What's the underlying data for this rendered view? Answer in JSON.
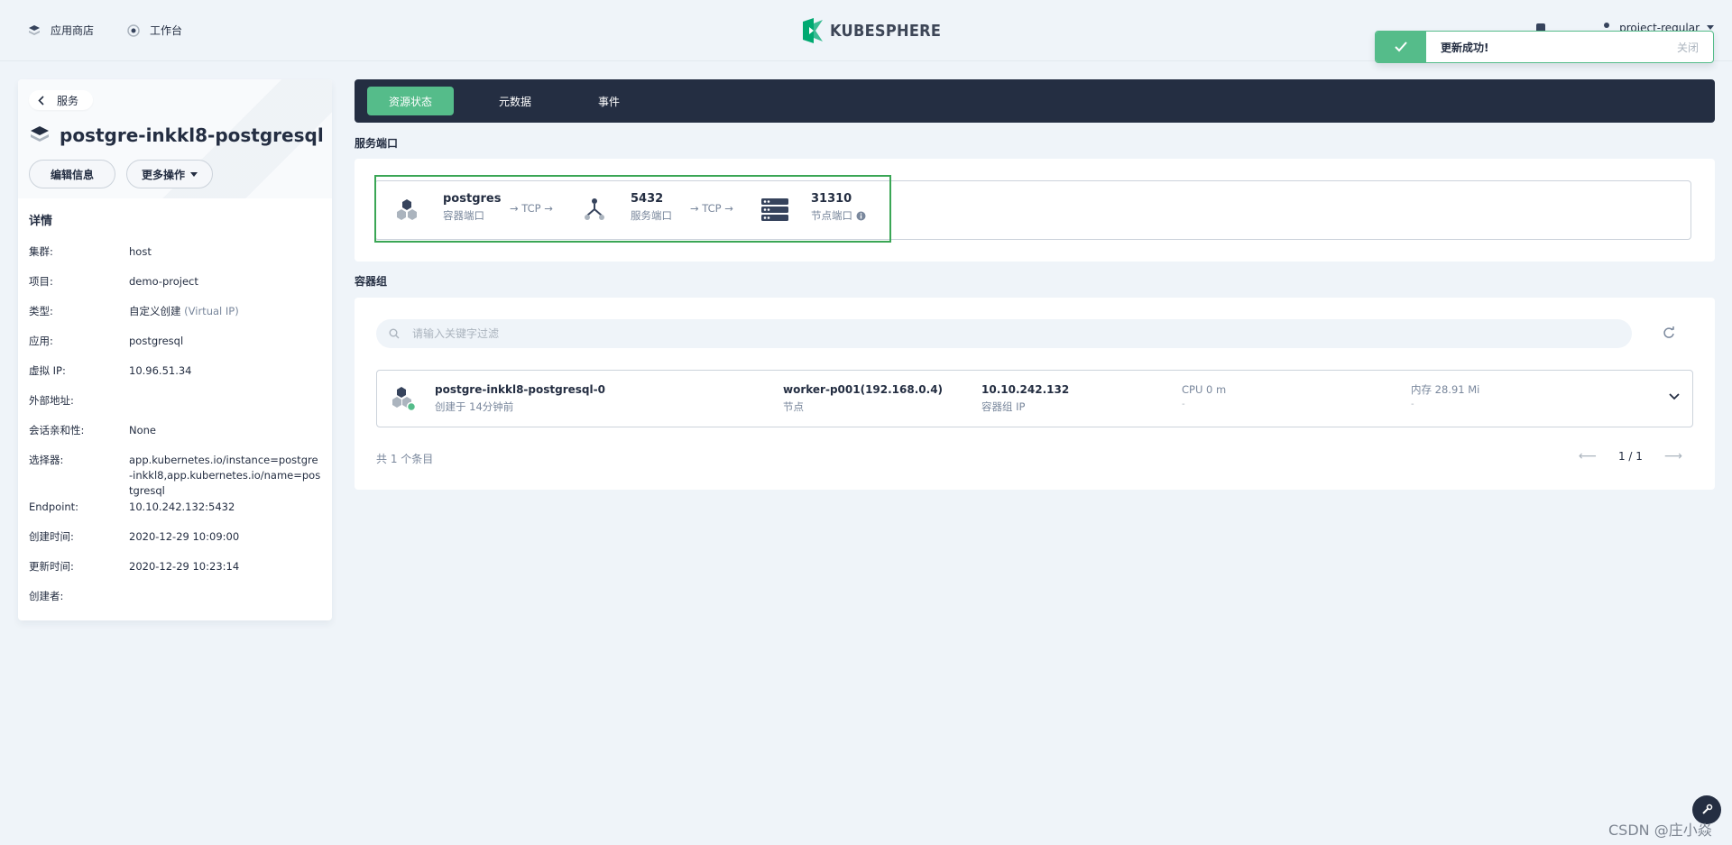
{
  "topnav": {
    "app_store": "应用商店",
    "workbench": "工作台",
    "logo": "KUBESPHERE",
    "user": "project-regular"
  },
  "toast": {
    "message": "更新成功!",
    "close": "关闭"
  },
  "left": {
    "back_label": "服务",
    "service_name": "postgre-inkkl8-postgresql",
    "edit_button": "编辑信息",
    "more_button": "更多操作",
    "details_title": "详情",
    "details": [
      {
        "key": "集群:",
        "value": "host"
      },
      {
        "key": "项目:",
        "value": "demo-project"
      },
      {
        "key": "类型:",
        "value": "自定义创建",
        "extra": "(Virtual IP)"
      },
      {
        "key": "应用:",
        "value": "postgresql"
      },
      {
        "key": "虚拟 IP:",
        "value": "10.96.51.34"
      },
      {
        "key": "外部地址:",
        "value": ""
      },
      {
        "key": "会话亲和性:",
        "value": "None"
      },
      {
        "key": "选择器:",
        "value": "app.kubernetes.io/instance=postgre-inkkl8,app.kubernetes.io/name=postgresql"
      },
      {
        "key": "Endpoint:",
        "value": "10.10.242.132:5432"
      },
      {
        "key": "创建时间:",
        "value": "2020-12-29 10:09:00"
      },
      {
        "key": "更新时间:",
        "value": "2020-12-29 10:23:14"
      },
      {
        "key": "创建者:",
        "value": ""
      }
    ]
  },
  "tabs": [
    "资源状态",
    "元数据",
    "事件"
  ],
  "ports": {
    "section_title": "服务端口",
    "container_port_name": "postgres",
    "container_port_label": "容器端口",
    "protocol1": "→ TCP →",
    "service_port": "5432",
    "service_port_label": "服务端口",
    "protocol2": "→ TCP →",
    "node_port": "31310",
    "node_port_label": "节点端口"
  },
  "pods": {
    "section_title": "容器组",
    "search_placeholder": "请输入关键字过滤",
    "row": {
      "name": "postgre-inkkl8-postgresql-0",
      "created": "创建于 14分钟前",
      "node": "worker-p001(192.168.0.4)",
      "node_label": "节点",
      "ip": "10.10.242.132",
      "ip_label": "容器组 IP",
      "cpu": "CPU 0 m",
      "cpu_sub": "-",
      "memory": "内存 28.91 Mi",
      "memory_sub": "-"
    },
    "total": "共 1 个条目",
    "page": "1 / 1"
  },
  "watermark": "CSDN @庄小焱",
  "colors": {
    "accent": "#55bc8a",
    "dark": "#242e42",
    "highlight": "#3aa655"
  }
}
